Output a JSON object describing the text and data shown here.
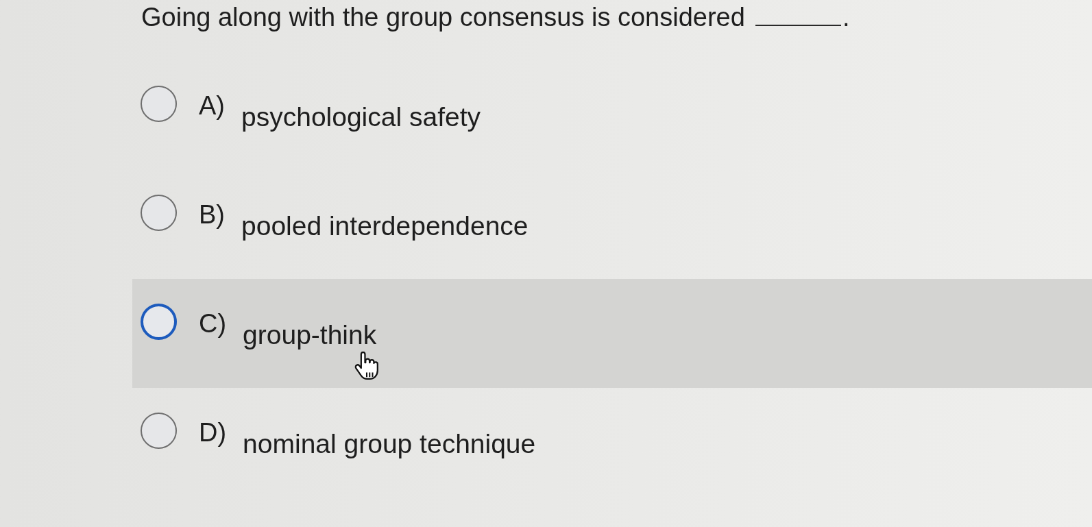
{
  "question": {
    "text": "Going along with the group consensus is considered",
    "punctuation": "."
  },
  "options": [
    {
      "letter": "A)",
      "text": "psychological safety",
      "selected": false,
      "hovered": false
    },
    {
      "letter": "B)",
      "text": "pooled interdependence",
      "selected": false,
      "hovered": false
    },
    {
      "letter": "C)",
      "text": "group-think",
      "selected": false,
      "hovered": true
    },
    {
      "letter": "D)",
      "text": "nominal group technique",
      "selected": false,
      "hovered": false
    }
  ]
}
